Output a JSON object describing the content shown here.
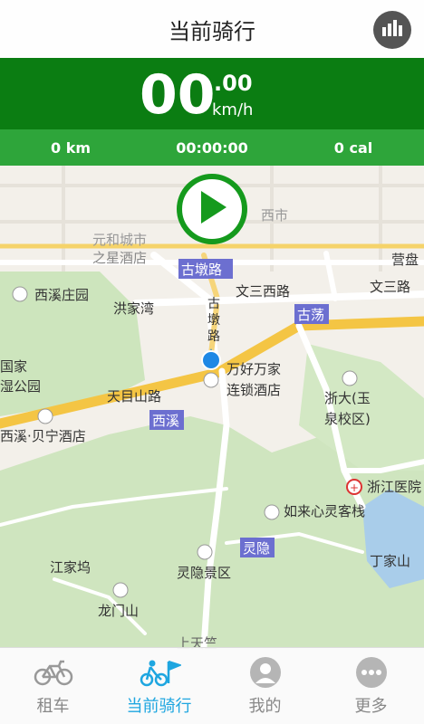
{
  "header": {
    "title": "当前骑行",
    "stats_icon": "bar-chart-icon"
  },
  "speed": {
    "value": "00",
    "decimal": ".00",
    "unit": "km/h"
  },
  "metrics": {
    "distance": "0 km",
    "duration": "00:00:00",
    "calories": "0 cal"
  },
  "play_button": {
    "icon": "play-icon"
  },
  "map": {
    "labels": {
      "xixi_zhuangyuan": "西溪庄园",
      "hongjiawan": "洪家湾",
      "gudun_lu": "古墩路",
      "gudun_lu_vertical": "古墩路",
      "wensan_xilu": "文三西路",
      "wensan_lu": "文三路",
      "gudang": "古荡",
      "tianmushan_lu": "天目山路",
      "wanhao_hotel": "万好万家\n连锁酒店",
      "zheda_yuquan": "浙大(玉\n泉校区)",
      "xixi_station": "西溪",
      "xixi_beining": "西溪·贝宁酒店",
      "guojia_gongyuan": "国家\n湿公园",
      "zhejiang_hospital": "浙江医院",
      "rulaixin": "如来心灵客栈",
      "lingyin_station": "灵隐",
      "lingyin_scenic": "灵隐景区",
      "jiangjiawu": "江家坞",
      "dingjiashan": "丁家山",
      "longmenshan": "龙门山",
      "shangtianzhu": "上天竺",
      "yuanhe_city": "元和城市",
      "zhixing_hotel": "之星酒店",
      "yingdi": "营盘",
      "xishi": "西市"
    }
  },
  "tabs": [
    {
      "label": "租车",
      "icon": "bicycle-icon",
      "active": false
    },
    {
      "label": "当前骑行",
      "icon": "riding-flag-icon",
      "active": true
    },
    {
      "label": "我的",
      "icon": "user-icon",
      "active": false
    },
    {
      "label": "更多",
      "icon": "more-icon",
      "active": false
    }
  ],
  "colors": {
    "dark_green": "#0b7d12",
    "green": "#2ea53a",
    "accent": "#1ea6e0"
  }
}
